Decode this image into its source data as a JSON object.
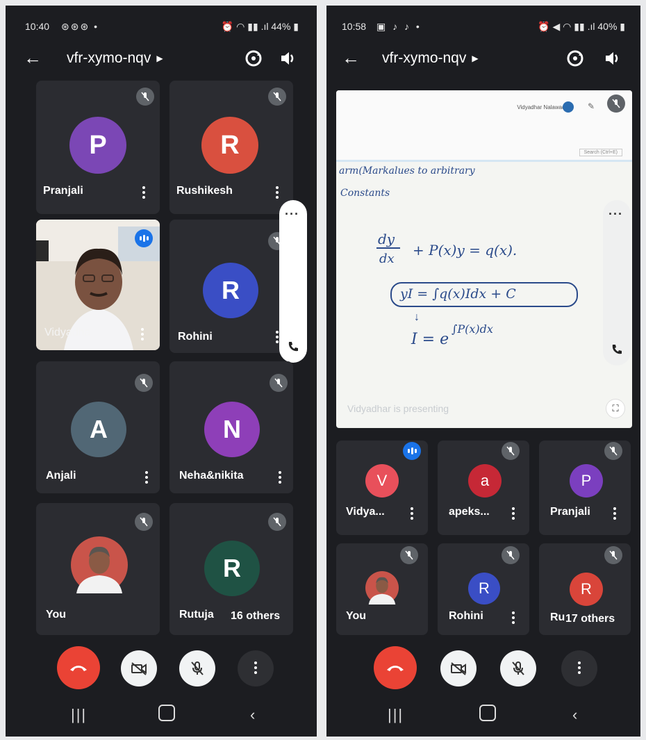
{
  "left": {
    "status_time": "10:40",
    "status_battery": "44%",
    "meeting_code": "vfr-xymo-nqv",
    "tiles": [
      {
        "name": "Pranjali",
        "initial": "P",
        "color": "#7b47b5"
      },
      {
        "name": "Rushikesh",
        "initial": "R",
        "color": "#d9503f"
      },
      {
        "name": "Vidyadha",
        "initial": "",
        "color": "#9aa0a6"
      },
      {
        "name": "Rohini",
        "initial": "R",
        "color": "#3a4ec5"
      },
      {
        "name": "Anjali",
        "initial": "A",
        "color": "#516775"
      },
      {
        "name": "Neha&nikita",
        "initial": "N",
        "color": "#8e3fb8"
      },
      {
        "name": "You",
        "initial": "",
        "color": "#c9544a"
      },
      {
        "name": "Rutuja",
        "initial": "R",
        "color": "#1f5244"
      }
    ],
    "others_label": "16 others"
  },
  "right": {
    "status_time": "10:58",
    "status_battery": "40%",
    "meeting_code": "vfr-xymo-nqv",
    "presentation": {
      "presenter_top": "Vidyadhar Nalawade",
      "search_text": "Search (Ctrl+E)",
      "line1": "arm(Markalues to arbitrary",
      "line2": "Constants",
      "eq1_num": "dy",
      "eq1_den": "dx",
      "eq1_rest": "+ P(x)y = q(x).",
      "eq2": "yI = ∫q(x)Idx + C",
      "eq3": "I = e",
      "eq3_exp": "∫P(x)dx",
      "caption": "Vidyadhar is presenting"
    },
    "tiles": [
      {
        "name": "Vidya...",
        "initial": "V",
        "color": "#e8505b"
      },
      {
        "name": "apeks...",
        "initial": "a",
        "color": "#c62836"
      },
      {
        "name": "Pranjali",
        "initial": "P",
        "color": "#7b3fbf"
      },
      {
        "name": "You",
        "initial": "",
        "color": "#c9544a"
      },
      {
        "name": "Rohini",
        "initial": "R",
        "color": "#3a4ec5"
      },
      {
        "name": "Ru",
        "initial": "R",
        "color": "#d9453a"
      }
    ],
    "others_label": "17 others"
  },
  "controls": [
    "end-call",
    "camera-off",
    "mic-off",
    "more-options"
  ]
}
